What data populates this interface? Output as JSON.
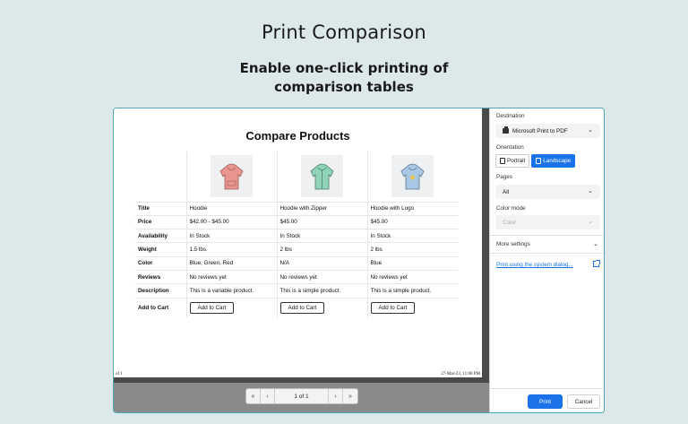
{
  "hero": {
    "title": "Print Comparison",
    "subtitle": "Enable one-click printing of comparison tables"
  },
  "sheet": {
    "title": "Compare Products",
    "footer_left": "of 1",
    "footer_right": "27-Mar-23, 11:08 PM",
    "products": [
      {
        "thumb_icon": "hoodie-pink-icon",
        "color": "#e8958f"
      },
      {
        "thumb_icon": "hoodie-zipper-green-icon",
        "color": "#8fd3b8"
      },
      {
        "thumb_icon": "hoodie-logo-blue-icon",
        "color": "#a9c8e6"
      }
    ],
    "rows": [
      {
        "label": "Title",
        "values": [
          "Hoodie",
          "Hoodie with Zipper",
          "Hoodie with Logo"
        ]
      },
      {
        "label": "Price",
        "values": [
          "$42.00 - $45.00",
          "$45.00",
          "$45.00"
        ]
      },
      {
        "label": "Availability",
        "values": [
          "In Stock",
          "In Stock",
          "In Stock"
        ]
      },
      {
        "label": "Weight",
        "values": [
          "1.5 lbs",
          "2 lbs",
          "2 lbs"
        ]
      },
      {
        "label": "Color",
        "values": [
          "Blue, Green, Red",
          "N/A",
          "Blue"
        ]
      },
      {
        "label": "Reviews",
        "values": [
          "No reviews yet",
          "No reviews yet",
          "No reviews yet"
        ]
      },
      {
        "label": "Description",
        "values": [
          "This is a variable product.",
          "This is a simple product.",
          "This is a simple product."
        ]
      }
    ],
    "cart_label": "Add to Cart",
    "cart_button": "Add to Cart"
  },
  "pager": {
    "first": "«",
    "prev": "‹",
    "info": "1 of 1",
    "next": "›",
    "last": "»"
  },
  "panel": {
    "destination_label": "Destination",
    "destination_value": "Microsoft Print to PDF",
    "orientation_label": "Orientation",
    "portrait": "Portrait",
    "landscape": "Landscape",
    "pages_label": "Pages",
    "pages_value": "All",
    "color_mode_label": "Color mode",
    "color_mode_value": "Color",
    "more_settings": "More settings",
    "system_dialog": "Print using the system dialog...",
    "print": "Print",
    "cancel": "Cancel",
    "chevron": "⌄"
  },
  "colors": {
    "accent": "#1a73e8",
    "frame_border": "#4fa8b4",
    "background": "#dde8ea"
  }
}
